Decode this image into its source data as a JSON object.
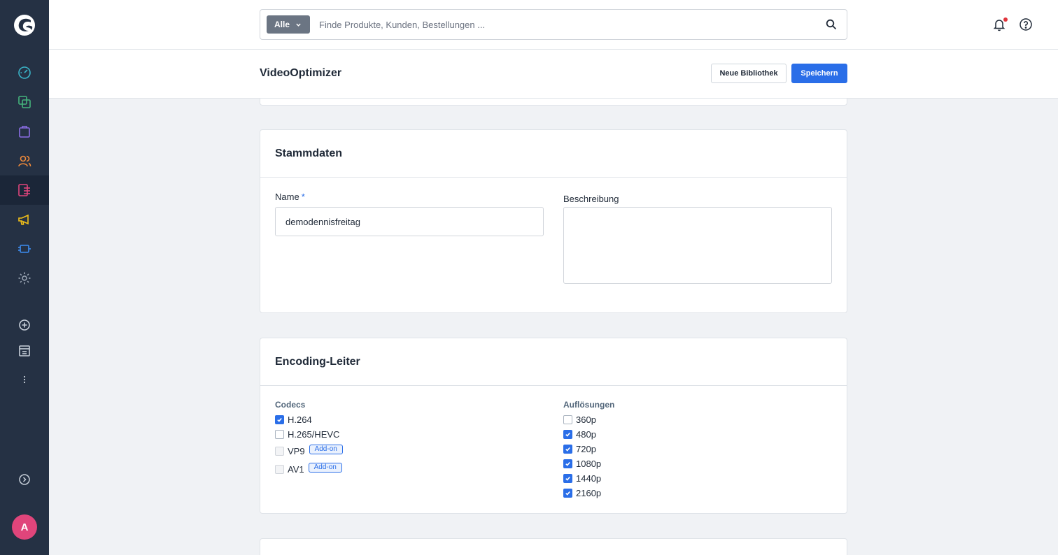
{
  "sidebar": {
    "logo": "shopware-logo",
    "items": [
      {
        "name": "dashboard-icon",
        "color": "#3ab5c9"
      },
      {
        "name": "catalog-icon",
        "color": "#45b47c"
      },
      {
        "name": "orders-icon",
        "color": "#8b6ee5"
      },
      {
        "name": "customers-icon",
        "color": "#f08a3a"
      },
      {
        "name": "content-icon",
        "color": "#e0457b"
      },
      {
        "name": "marketing-icon",
        "color": "#f2c019"
      },
      {
        "name": "extensions-icon",
        "color": "#3d8cf0"
      },
      {
        "name": "settings-icon",
        "color": "#9aa5b3"
      }
    ],
    "avatar_initial": "A"
  },
  "header": {
    "search_filter": "Alle",
    "search_placeholder": "Finde Produkte, Kunden, Bestellungen ..."
  },
  "smartbar": {
    "title": "VideoOptimizer",
    "secondary_button": "Neue Bibliothek",
    "primary_button": "Speichern"
  },
  "stammdaten": {
    "title": "Stammdaten",
    "name_label": "Name",
    "name_required": "*",
    "name_value": "demodennisfreitag",
    "description_label": "Beschreibung",
    "description_value": ""
  },
  "encoding": {
    "title": "Encoding-Leiter",
    "codecs_label": "Codecs",
    "codecs": [
      {
        "label": "H.264",
        "checked": true,
        "disabled": false,
        "badge": ""
      },
      {
        "label": "H.265/HEVC",
        "checked": false,
        "disabled": false,
        "badge": ""
      },
      {
        "label": "VP9",
        "checked": false,
        "disabled": true,
        "badge": "Add-on"
      },
      {
        "label": "AV1",
        "checked": false,
        "disabled": true,
        "badge": "Add-on"
      }
    ],
    "resolutions_label": "Auflösungen",
    "resolutions": [
      {
        "label": "360p",
        "checked": false
      },
      {
        "label": "480p",
        "checked": true
      },
      {
        "label": "720p",
        "checked": true
      },
      {
        "label": "1080p",
        "checked": true
      },
      {
        "label": "1440p",
        "checked": true
      },
      {
        "label": "2160p",
        "checked": true
      }
    ]
  },
  "colors": {
    "sidebar": "#253144",
    "primary": "#2a6ee8",
    "avatar": "#e0457b"
  }
}
